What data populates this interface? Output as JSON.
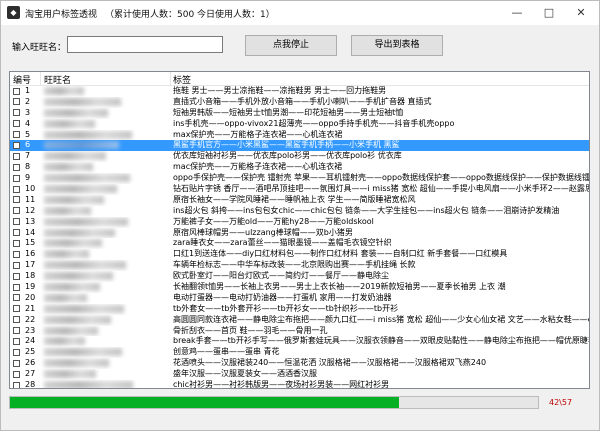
{
  "window": {
    "title": "淘宝用户标签透视",
    "stats": "（累计使用人数：500   今日使用人数：1）",
    "minimize": "—",
    "maximize": "□",
    "close": "✕"
  },
  "toolbar": {
    "input_label": "输入旺旺名：",
    "input_value": "",
    "start_stop_label": "点我停止",
    "export_label": "导出到表格"
  },
  "table": {
    "headers": {
      "num": "编号",
      "nick": "旺旺名",
      "tags": "标签"
    },
    "selected_index": 5,
    "rows": [
      {
        "num": "1",
        "tags": "拖鞋 男士——男士凉拖鞋——凉拖鞋男 男士——回力拖鞋男"
      },
      {
        "num": "2",
        "tags": "直插式小音箱——手机外放小音箱——手机小喇叭——手机扩音器 直插式"
      },
      {
        "num": "3",
        "tags": "短袖男韩版——短袖男士t恤男潮——印花短袖男——男士短袖t恤"
      },
      {
        "num": "4",
        "tags": "ins手机壳——oppo-vivox21超薄壳——oppo手持手机壳——抖音手机壳oppo"
      },
      {
        "num": "5",
        "tags": "max保护壳——万能格子连衣裙——心机连衣裙"
      },
      {
        "num": "6",
        "tags": "黑鲨手机官方——小米黑鲨——黑鲨手机手柄——小米手机 黑鲨"
      },
      {
        "num": "7",
        "tags": "优衣库短袖衬衫男——优衣库polo衫男——优衣库polo衫 优衣库"
      },
      {
        "num": "8",
        "tags": "mac保护壳——万能格子连衣裙——心机连衣裙"
      },
      {
        "num": "9",
        "tags": "oppo手保护壳——保护壳 镭射壳 苹果——耳机镭射壳——oppo数据线保护套——oppo数据线保护——保护数据线镭射壳"
      },
      {
        "num": "10",
        "tags": "钻石贴片字锈 香厅——酒吧吊顶挂吧——氛围灯具——i miss猪 宽松 超仙——手提小电风扇——小米手环2——赵露思同款"
      },
      {
        "num": "11",
        "tags": "原宿长袖女——学院风睡裙——睡帆袖上衣 学生——简版睡裙宽松风"
      },
      {
        "num": "12",
        "tags": "ins超火包 斜挎——ins包包女chic——chic包包 链条——大学生挂包——ins超火包 链条——泪崩诗护发精油"
      },
      {
        "num": "13",
        "tags": "万能裤子女——万能old——万能hy28——万能oldskool"
      },
      {
        "num": "14",
        "tags": "原宿风棒球帽男——ulzzang棒球帽——双b小猪男"
      },
      {
        "num": "15",
        "tags": "zara睡衣女——zara蕾丝——猫眼墨镜——盖帽毛衣镜空针织"
      },
      {
        "num": "16",
        "tags": "口红1到送连体——diy口红材料包——制作口红材料 套装——自制口红 新手套餐——口红模具"
      },
      {
        "num": "17",
        "tags": "车辆年检标志——中华车标改装——北京限购出赛——手机挂绳 长款"
      },
      {
        "num": "18",
        "tags": "欧式卧室灯——阳台灯欧式——简约灯——餐厅——静电除尘"
      },
      {
        "num": "19",
        "tags": "长袖翻领t恤男——长袖上衣男——男士上衣长袖——2019新款短袖男——夏季长袖男 上衣 潮"
      },
      {
        "num": "20",
        "tags": "电动打蛋器——电动打奶油器——打蛋机 家用——打发奶油器"
      },
      {
        "num": "21",
        "tags": "tb外套女——tb外套开衫——tb开衫女——tb针织衫——tb开衫"
      },
      {
        "num": "22",
        "tags": "高圆圆同款连衣裙——静电除尘布拖把——颜九口红——i miss猪 宽松 超仙——少女心仙女裙 文艺——水粘女鞋——olay小白瓶"
      },
      {
        "num": "23",
        "tags": "骨折刮衣——首页 鞋——羽毛——骨用一孔"
      },
      {
        "num": "24",
        "tags": "break手套——tb开衫手写——俄罗斯套娃玩具——汉服衣领静音——双眼皮贴黏性——静电除尘布拖把——帽优原睫毛膏——olay小红衫——泰国"
      },
      {
        "num": "25",
        "tags": "创意鸡——蛋串——蛋串 青花"
      },
      {
        "num": "26",
        "tags": "花酒喷头——汉服裙装240——恒温花洒 汉服格裙——汉服格裙——汉服格裙双飞燕240"
      },
      {
        "num": "27",
        "tags": "盛年汉服——汉服夏装女——酒酒香汉服"
      },
      {
        "num": "28",
        "tags": "chic衬衫男——衬衫韩版男——夜场衬衫男装——网红衬衫男"
      },
      {
        "num": "29",
        "tags": "汉服斜挎包——森系双肩包——手工刺绣包布小清新——刺绣帆布包——汉服包斜挎"
      },
      {
        "num": "30",
        "tags": "睡眠耳塞 女生——手链精制睡眠 耳塞——少女心仙女裙——手链精制睡眠"
      }
    ]
  },
  "progress": {
    "fraction": 0.737,
    "count_text": "42\\57",
    "bar_color": "#06b025",
    "count_color": "#c00000"
  },
  "colors": {
    "selection": "#3399ff",
    "window_bg": "#f0f0f0"
  }
}
